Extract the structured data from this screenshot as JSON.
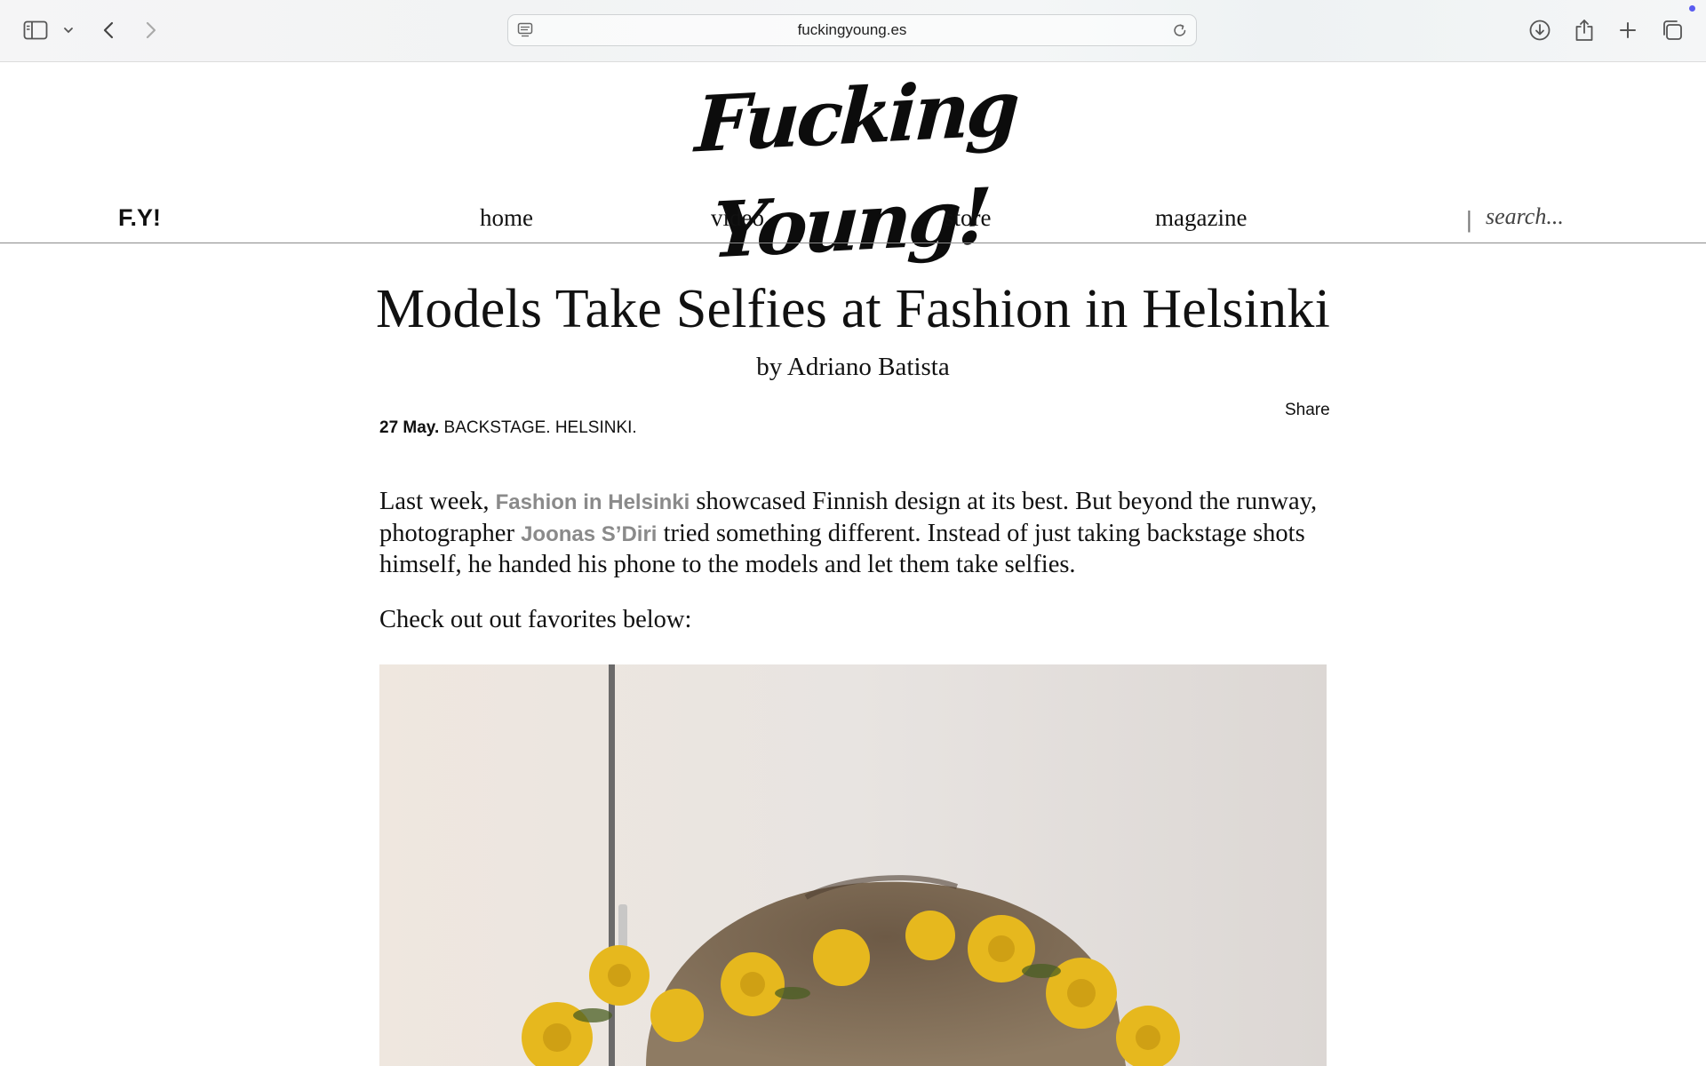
{
  "browser": {
    "url": "fuckingyoung.es",
    "extension_dot_color": "#5a5cf0"
  },
  "site": {
    "logo_text": "Fucking Young!",
    "short_mark": "F.Y!",
    "nav": [
      {
        "label": "home"
      },
      {
        "label": "video"
      },
      {
        "label": "store"
      },
      {
        "label": "magazine"
      }
    ],
    "nav_separator": "|",
    "search_placeholder": "search..."
  },
  "article": {
    "title": "Models Take Selfies at Fashion in Helsinki",
    "byline": "by Adriano Batista",
    "share_label": "Share",
    "date": "27 May.",
    "tags": "BACKSTAGE. HELSINKI.",
    "paragraph1": {
      "t1": "Last week, ",
      "link1": "Fashion in Helsinki",
      "t2": " showcased Finnish design at its best. But beyond the runway, photographer ",
      "link2": "Joonas S’Diri",
      "t3": " tried something different. Instead of just taking backstage shots himself, he handed his phone to the models and let them take selfies."
    },
    "paragraph2": "Check out out favorites below:",
    "link_color": "#8a8a8a"
  },
  "icons": {
    "sidebar": "sidebar-icon",
    "sidebar_menu": "chevron-down-icon",
    "back": "chevron-left-icon",
    "forward": "chevron-right-icon",
    "reader": "reader-mode-icon",
    "reload": "reload-icon",
    "download": "download-icon",
    "share": "share-icon",
    "new_tab": "plus-icon",
    "tabs": "tab-overview-icon"
  }
}
